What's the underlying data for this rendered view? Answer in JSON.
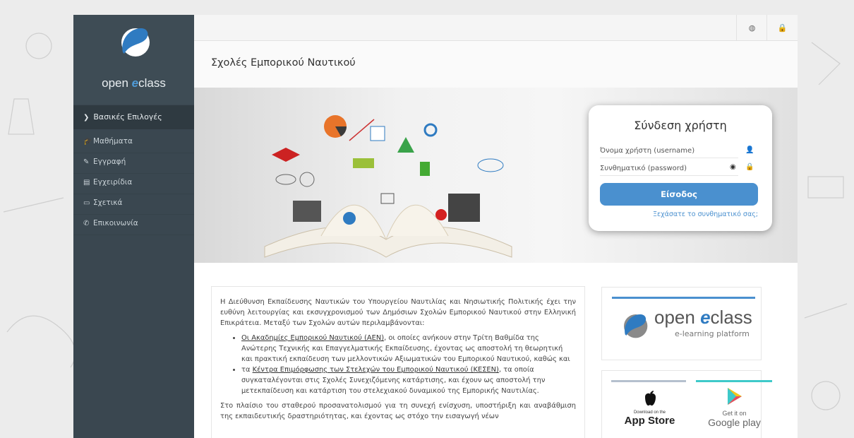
{
  "brand": {
    "name_prefix": "open ",
    "name_accent": "e",
    "name_suffix": "class"
  },
  "sidebar": {
    "section_label": "Βασικές Επιλογές",
    "items": [
      {
        "label": "Μαθήματα",
        "icon": "graduation-cap-icon"
      },
      {
        "label": "Εγγραφή",
        "icon": "edit-icon"
      },
      {
        "label": "Εγχειρίδια",
        "icon": "file-icon"
      },
      {
        "label": "Σχετικά",
        "icon": "credit-card-icon"
      },
      {
        "label": "Επικοινωνία",
        "icon": "phone-icon"
      }
    ]
  },
  "header": {
    "title": "Σχολές Εμπορικού Ναυτικού",
    "icons": [
      "globe-icon",
      "lock-icon"
    ]
  },
  "login": {
    "title": "Σύνδεση χρήστη",
    "username_placeholder": "Όνομα χρήστη (username)",
    "password_placeholder": "Συνθηματικό (password)",
    "submit_label": "Είσοδος",
    "forgot_link": "Ξεχάσατε το συνθηματικό σας;"
  },
  "content": {
    "intro": "Η Διεύθυνση Εκπαίδευσης Ναυτικών του Υπουργείου Ναυτιλίας και Νησιωτικής Πολιτικής έχει την ευθύνη λειτουργίας και εκσυγχρονισμού των Δημόσιων Σχολών Εμπορικού Ναυτικού στην Ελληνική Επικράτεια. Μεταξύ των Σχολών αυτών περιλαμβάνονται:",
    "bullet1_link": "Οι Ακαδημίες Εμπορικού Ναυτικού (ΑΕΝ)",
    "bullet1_text": ", οι οποίες ανήκουν στην Τρίτη Βαθμίδα της Ανώτερης Τεχνικής και Επαγγελματικής Εκπαίδευσης, έχοντας ως αποστολή τη θεωρητική και πρακτική εκπαίδευση των μελλοντικών Αξιωματικών του Εμπορικού Ναυτικού, καθώς και",
    "bullet2_prefix": "τα ",
    "bullet2_link": "Κέντρα Επιμόρφωσης των Στελεχών του Εμπορικού Ναυτικού (ΚΕΣΕΝ)",
    "bullet2_text": ", τα οποία συγκαταλέγονται στις Σχολές Συνεχιζόμενης κατάρτισης, και έχουν ως αποστολή την μετεκπαίδευση και κατάρτιση του στελεχιακού δυναμικού της Εμπορικής Ναυτιλίας.",
    "closing": "Στο πλαίσιο του σταθερού προσανατολισμού για τη συνεχή ενίσχυση, υποστήριξη και αναβάθμιση της εκπαιδευτικής δραστηριότητας, και έχοντας ως στόχο την εισαγωγή νέων"
  },
  "side": {
    "logo_prefix": "open ",
    "logo_accent": "e",
    "logo_suffix": "class",
    "logo_sub": "e-learning platform",
    "appstore_small": "Download on the",
    "appstore_big": "App Store",
    "gplay_small": "Get it on",
    "gplay_big": "Google play"
  },
  "colors": {
    "sidebar": "#3a4750",
    "accent": "#4a90cf",
    "gplay_bar": "#3ec9c9"
  }
}
